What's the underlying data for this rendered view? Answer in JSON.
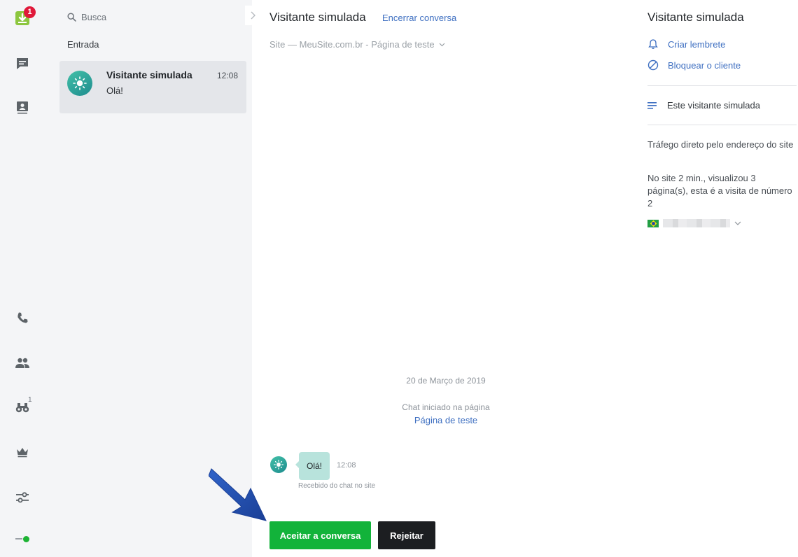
{
  "rail": {
    "inbox_badge": "1",
    "monitor_count": "1"
  },
  "list": {
    "search_placeholder": "Busca",
    "section_label": "Entrada",
    "chats": [
      {
        "name": "Visitante simulada",
        "time": "12:08",
        "preview": "Olá!"
      }
    ]
  },
  "conversation": {
    "title": "Visitante simulada",
    "end_chat_label": "Encerrar conversa",
    "site_line": "Site — MeuSite.com.br - Página de teste",
    "date_label": "20 de Março de 2019",
    "started_label": "Chat iniciado na página",
    "page_link": "Página de teste",
    "message": {
      "text": "Olá!",
      "time": "12:08",
      "caption": "Recebido do chat no site"
    },
    "accept_label": "Aceitar a conversa",
    "reject_label": "Rejeitar"
  },
  "info": {
    "title": "Visitante simulada",
    "reminder_label": "Criar lembrete",
    "block_label": "Bloquear o cliente",
    "note_label": "Este visitante simulada",
    "traffic_text": "Tráfego direto pelo endereço do site",
    "visit_text": "No site 2 min., visualizou 3 página(s), esta é a visita de número 2"
  },
  "colors": {
    "accent_green": "#12b33a",
    "link_blue": "#3e6fc1",
    "badge_red": "#e0193a",
    "status_online": "#1db333"
  }
}
